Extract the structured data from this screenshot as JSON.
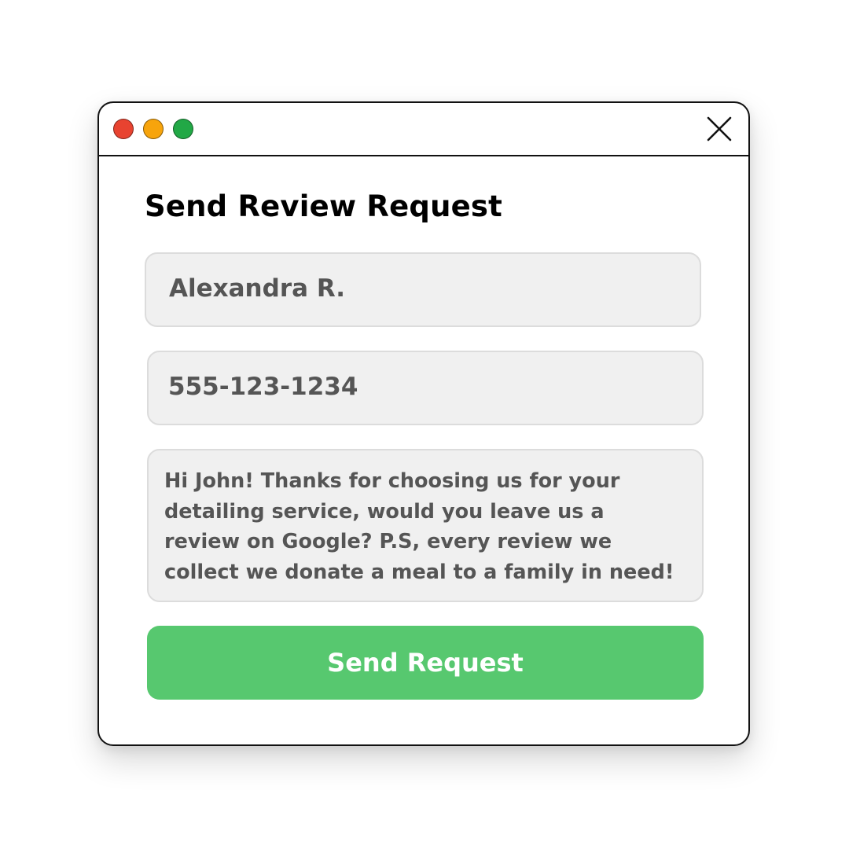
{
  "window": {
    "controls": {
      "close_color": "#e84330",
      "minimize_color": "#f7a40c",
      "maximize_color": "#22a846",
      "close_icon": "x-icon"
    }
  },
  "form": {
    "title": "Send Review Request",
    "name_value": "Alexandra R.",
    "phone_value": "555-123-1234",
    "message_lines": [
      "Hi John! Thanks for choosing us for your",
      "detailing service, would you leave us a",
      "review on Google? P.S, every review we",
      "collect we donate a meal to a family in need!"
    ],
    "submit_label": "Send Request"
  },
  "colors": {
    "accent": "#57c86f",
    "field_background": "#f0f0f0",
    "field_text": "#555555"
  }
}
